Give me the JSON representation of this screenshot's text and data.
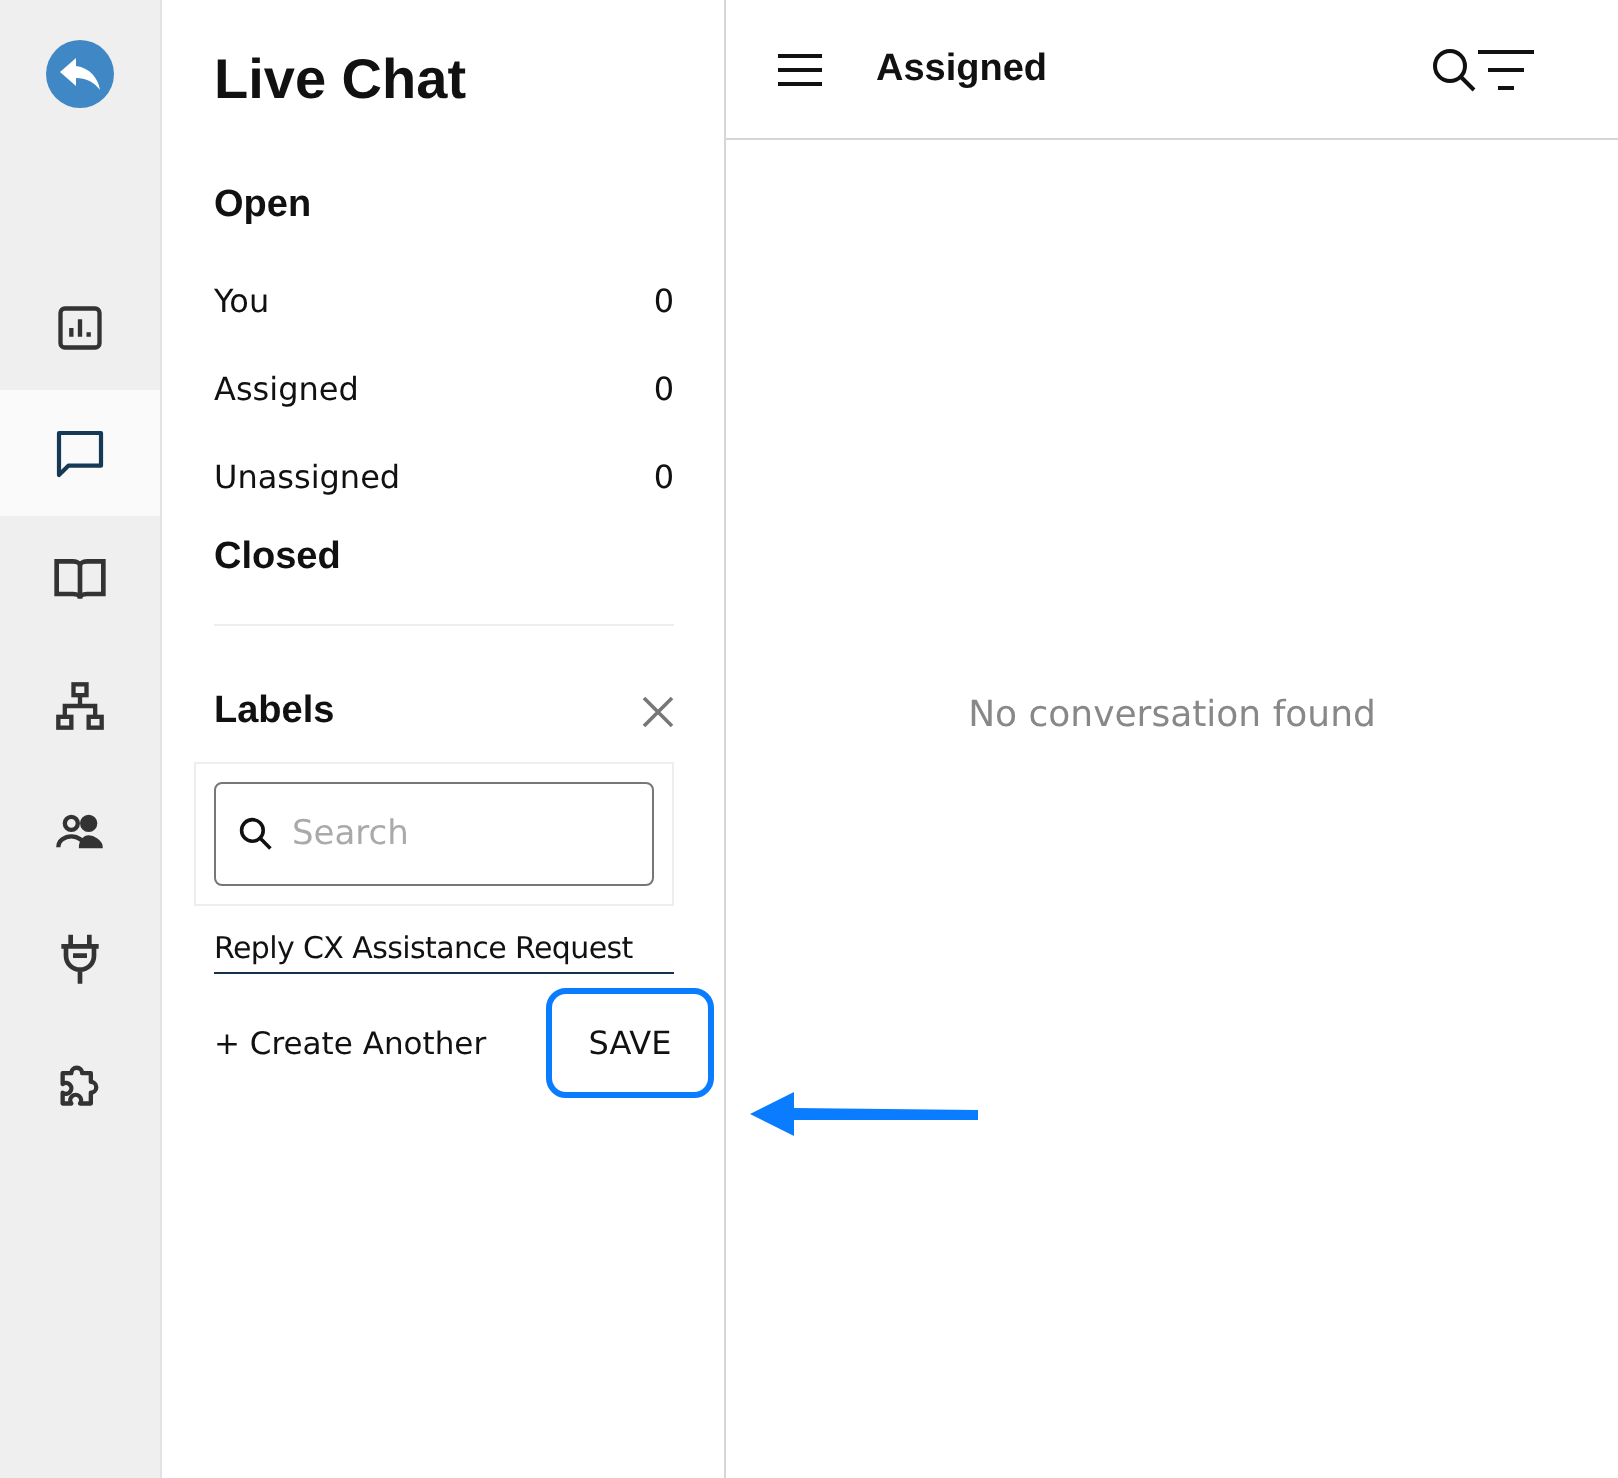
{
  "nav": [
    {
      "kind": "chart",
      "selected": false
    },
    {
      "kind": "chat",
      "selected": true
    },
    {
      "kind": "book",
      "selected": false
    },
    {
      "kind": "hierarchy",
      "selected": false
    },
    {
      "kind": "people",
      "selected": false
    },
    {
      "kind": "plug",
      "selected": false
    },
    {
      "kind": "puzzle",
      "selected": false
    }
  ],
  "panel": {
    "title": "Live Chat",
    "open_heading": "Open",
    "items": [
      {
        "label": "You",
        "count": "0"
      },
      {
        "label": "Assigned",
        "count": "0"
      },
      {
        "label": "Unassigned",
        "count": "0"
      }
    ],
    "closed_heading": "Closed",
    "labels_heading": "Labels",
    "search": {
      "placeholder": "Search"
    },
    "label_input": {
      "value": "Reply CX Assistance Request"
    },
    "create_link": "+ Create Another",
    "save_button": "SAVE"
  },
  "main": {
    "title": "Assigned",
    "empty_text": "No conversation found"
  }
}
